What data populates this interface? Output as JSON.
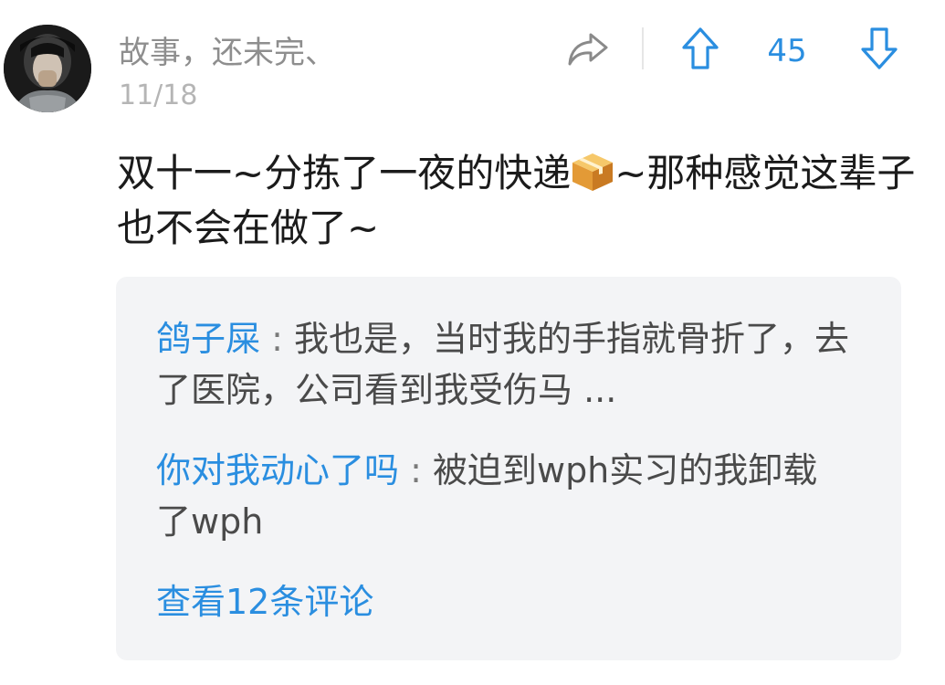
{
  "post": {
    "username": "故事，还未完、",
    "date": "11/18",
    "text_part1": "双十一~分拣了一夜的快递",
    "emoji": "package-emoji",
    "text_part2": "~那种感觉这辈子也不会在做了~"
  },
  "actions": {
    "share_icon": "share-icon",
    "upvote_icon": "arrow-up-icon",
    "vote_count": "45",
    "downvote_icon": "arrow-down-icon"
  },
  "comments": [
    {
      "author": "鸽子屎",
      "separator": " : ",
      "text": "我也是，当时我的手指就骨折了，去了医院，公司看到我受伤马 ..."
    },
    {
      "author": "你对我动心了吗",
      "separator": " : ",
      "text": "被迫到wph实习的我卸载了wph"
    }
  ],
  "view_all_label": "查看12条评论",
  "colors": {
    "accent": "#2a8ee0",
    "username": "#8e8e8e",
    "date": "#b5b5b5",
    "comment_bg": "#f3f4f6"
  }
}
